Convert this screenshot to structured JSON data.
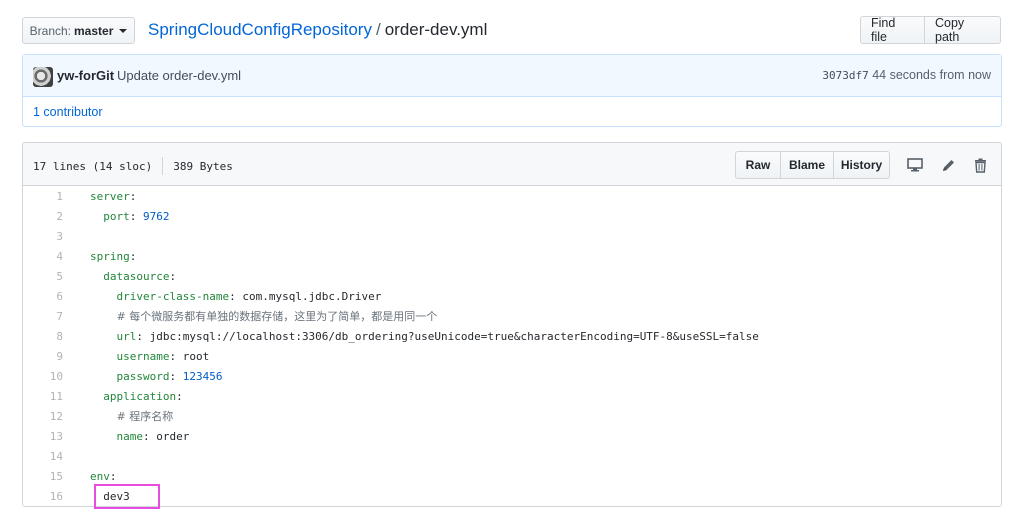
{
  "branch": {
    "prefix": "Branch:",
    "name": "master"
  },
  "breadcrumb": {
    "repo": "SpringCloudConfigRepository",
    "separator": "/",
    "file": "order-dev.yml"
  },
  "file_nav": {
    "find_file": "Find file",
    "copy_path": "Copy path"
  },
  "commit": {
    "author": "yw-forGit",
    "message": "Update order-dev.yml",
    "sha": "3073df7",
    "time": "44 seconds from now",
    "contributors": "1 contributor"
  },
  "file_header": {
    "lines": "17 lines (14 sloc)",
    "size": "389 Bytes",
    "raw": "Raw",
    "blame": "Blame",
    "history": "History",
    "icons": [
      "desktop-icon",
      "pencil-icon",
      "trash-icon"
    ]
  },
  "code": [
    {
      "n": "1",
      "tokens": [
        [
          "k",
          "server"
        ],
        [
          "s",
          ":"
        ]
      ]
    },
    {
      "n": "2",
      "tokens": [
        [
          "s",
          "  "
        ],
        [
          "k",
          "port"
        ],
        [
          "s",
          ": "
        ],
        [
          "v",
          "9762"
        ]
      ]
    },
    {
      "n": "3",
      "tokens": []
    },
    {
      "n": "4",
      "tokens": [
        [
          "k",
          "spring"
        ],
        [
          "s",
          ":"
        ]
      ]
    },
    {
      "n": "5",
      "tokens": [
        [
          "s",
          "  "
        ],
        [
          "k",
          "datasource"
        ],
        [
          "s",
          ":"
        ]
      ]
    },
    {
      "n": "6",
      "tokens": [
        [
          "s",
          "    "
        ],
        [
          "k",
          "driver-class-name"
        ],
        [
          "s",
          ": com.mysql.jdbc.Driver"
        ]
      ]
    },
    {
      "n": "7",
      "tokens": [
        [
          "s",
          "    "
        ],
        [
          "c",
          "# 每个微服务都有单独的数据存储，这里为了简单，都是用同一个"
        ]
      ]
    },
    {
      "n": "8",
      "tokens": [
        [
          "s",
          "    "
        ],
        [
          "k",
          "url"
        ],
        [
          "s",
          ": jdbc:mysql://localhost:3306/db_ordering?useUnicode=true&characterEncoding=UTF-8&useSSL=false"
        ]
      ]
    },
    {
      "n": "9",
      "tokens": [
        [
          "s",
          "    "
        ],
        [
          "k",
          "username"
        ],
        [
          "s",
          ": root"
        ]
      ]
    },
    {
      "n": "10",
      "tokens": [
        [
          "s",
          "    "
        ],
        [
          "k",
          "password"
        ],
        [
          "s",
          ": "
        ],
        [
          "v",
          "123456"
        ]
      ]
    },
    {
      "n": "11",
      "tokens": [
        [
          "s",
          "  "
        ],
        [
          "k",
          "application"
        ],
        [
          "s",
          ":"
        ]
      ]
    },
    {
      "n": "12",
      "tokens": [
        [
          "s",
          "    "
        ],
        [
          "c",
          "# 程序名称"
        ]
      ]
    },
    {
      "n": "13",
      "tokens": [
        [
          "s",
          "    "
        ],
        [
          "k",
          "name"
        ],
        [
          "s",
          ": order"
        ]
      ]
    },
    {
      "n": "14",
      "tokens": []
    },
    {
      "n": "15",
      "tokens": [
        [
          "k",
          "env"
        ],
        [
          "s",
          ":"
        ]
      ]
    },
    {
      "n": "16",
      "tokens": [
        [
          "s",
          "  dev3"
        ]
      ]
    }
  ],
  "colors": {
    "link": "#0366d6",
    "key": "#22863a",
    "number": "#005cc5",
    "highlight_box": "#e84ce0"
  }
}
